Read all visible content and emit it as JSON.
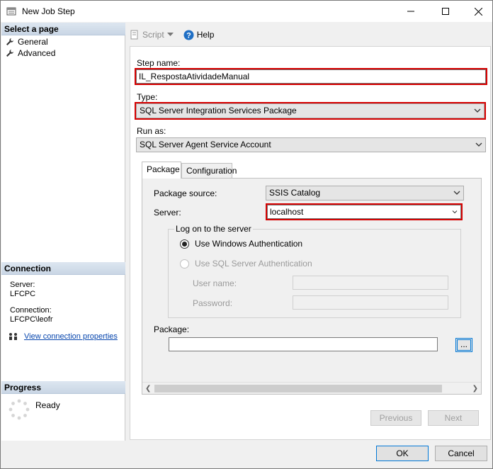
{
  "window": {
    "title": "New Job Step"
  },
  "left": {
    "select_page_header": "Select a page",
    "pages": [
      {
        "label": "General"
      },
      {
        "label": "Advanced"
      }
    ],
    "connection_header": "Connection",
    "server_label": "Server:",
    "server_value": "LFCPC",
    "connection_label": "Connection:",
    "connection_value": "LFCPC\\leofr",
    "view_connection_link": "View connection properties",
    "progress_header": "Progress",
    "progress_status": "Ready"
  },
  "toolbar": {
    "script_label": "Script",
    "help_label": "Help"
  },
  "form": {
    "step_name_label": "Step name:",
    "step_name_value": "IL_RespostaAtividadeManual",
    "type_label": "Type:",
    "type_value": "SQL Server Integration Services Package",
    "run_as_label": "Run as:",
    "run_as_value": "SQL Server Agent Service Account"
  },
  "tabs": [
    {
      "label": "Package"
    },
    {
      "label": "Configuration"
    }
  ],
  "package_tab": {
    "package_source_label": "Package source:",
    "package_source_value": "SSIS Catalog",
    "server_label": "Server:",
    "server_value": "localhost",
    "logon_group": "Log on to the server",
    "windows_auth": "Use Windows Authentication",
    "sql_auth": "Use SQL Server Authentication",
    "username_label": "User name:",
    "password_label": "Password:",
    "package_label": "Package:",
    "package_value": "",
    "browse_label": "..."
  },
  "buttons": {
    "previous": "Previous",
    "next": "Next",
    "ok": "OK",
    "cancel": "Cancel"
  }
}
